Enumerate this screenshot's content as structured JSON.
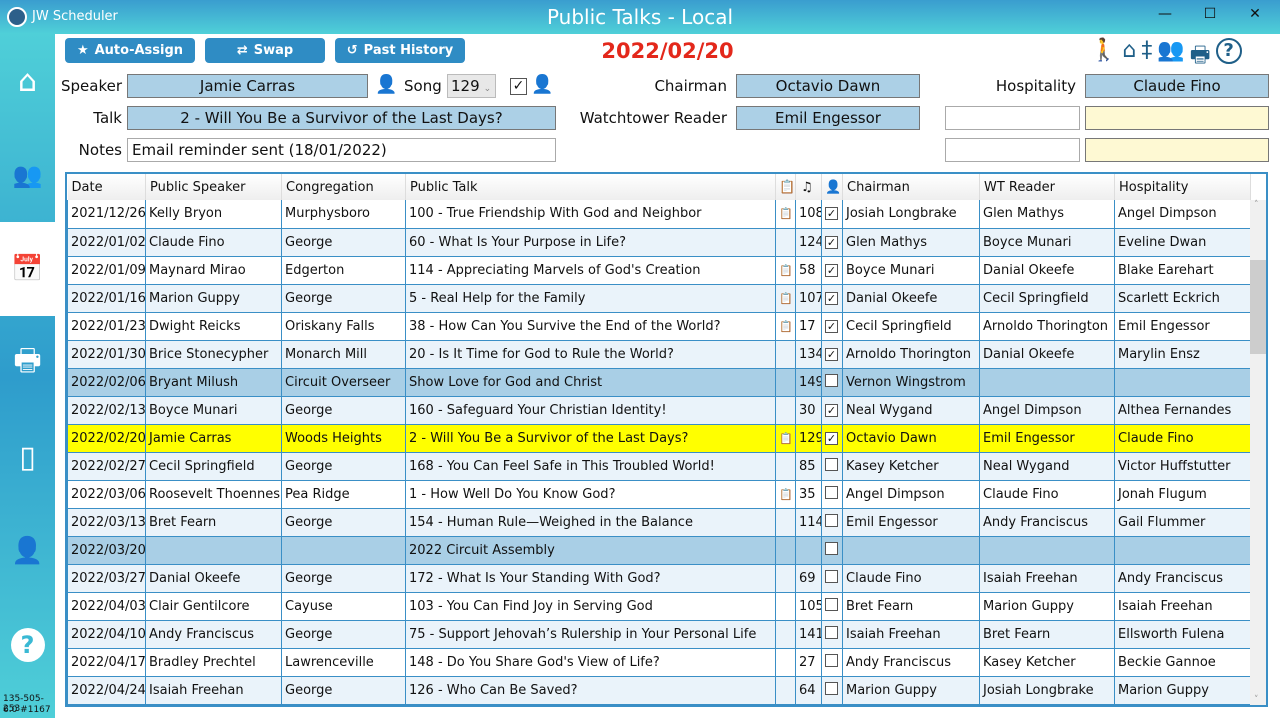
{
  "window": {
    "app_name": "JW Scheduler",
    "title": "Public Talks - Local",
    "minimize": "—",
    "maximize": "☐",
    "close": "✕"
  },
  "sidebar": {
    "items": [
      {
        "name": "home",
        "icon": "⌂"
      },
      {
        "name": "people",
        "icon": "👥"
      },
      {
        "name": "calendar",
        "icon": "📅",
        "active": true
      },
      {
        "name": "print",
        "icon": "🖶"
      },
      {
        "name": "phone",
        "icon": "▯"
      },
      {
        "name": "user-check",
        "icon": "👤"
      },
      {
        "name": "help",
        "icon": "?"
      }
    ],
    "version_line1": "135-505-253",
    "version_line2": "6.0 #1167"
  },
  "toolbar": {
    "auto_assign": "Auto-Assign",
    "swap": "Swap",
    "past_history": "Past History",
    "date": "2022/02/20"
  },
  "form": {
    "speaker_label": "Speaker",
    "speaker": "Jamie Carras",
    "song_label": "Song",
    "song": "129",
    "talk_label": "Talk",
    "talk": "2 - Will You Be a Survivor of the Last Days?",
    "notes_label": "Notes",
    "notes": "Email reminder sent (18/01/2022)",
    "chairman_label": "Chairman",
    "chairman": "Octavio Dawn",
    "reader_label": "Watchtower Reader",
    "reader": "Emil Engessor",
    "hospitality_label": "Hospitality",
    "hospitality": "Claude Fino"
  },
  "table": {
    "headers": [
      "Date",
      "Public Speaker",
      "Congregation",
      "Public Talk",
      "",
      "",
      "",
      "Chairman",
      "WT Reader",
      "Hospitality"
    ],
    "rows": [
      [
        "2021/12/26",
        "Kelly Bryon",
        "Murphysboro",
        "100 - True Friendship With God and Neighbor",
        true,
        "108",
        true,
        "Josiah Longbrake",
        "Glen Mathys",
        "Angel Dimpson",
        ""
      ],
      [
        "2022/01/02",
        "Claude Fino",
        "George",
        "60 - What Is Your Purpose in Life?",
        false,
        "124",
        true,
        "Glen Mathys",
        "Boyce Munari",
        "Eveline Dwan",
        ""
      ],
      [
        "2022/01/09",
        "Maynard Mirao",
        "Edgerton",
        "114 - Appreciating Marvels of God's Creation",
        true,
        "58",
        true,
        "Boyce Munari",
        "Danial Okeefe",
        "Blake Earehart",
        ""
      ],
      [
        "2022/01/16",
        "Marion Guppy",
        "George",
        "5 - Real Help for the Family",
        true,
        "107",
        true,
        "Danial Okeefe",
        "Cecil Springfield",
        "Scarlett Eckrich",
        ""
      ],
      [
        "2022/01/23",
        "Dwight Reicks",
        "Oriskany Falls",
        "38 - How Can You Survive the End of the World?",
        true,
        "17",
        true,
        "Cecil Springfield",
        "Arnoldo Thorington",
        "Emil Engessor",
        ""
      ],
      [
        "2022/01/30",
        "Brice Stonecypher",
        "Monarch Mill",
        "20 - Is It Time for God to Rule the World?",
        false,
        "134",
        true,
        "Arnoldo Thorington",
        "Danial Okeefe",
        "Marylin Ensz",
        ""
      ],
      [
        "2022/02/06",
        "Bryant Milush",
        "Circuit Overseer",
        "Show Love for God and Christ",
        false,
        "149",
        false,
        "Vernon Wingstrom",
        "",
        "",
        "special"
      ],
      [
        "2022/02/13",
        "Boyce Munari",
        "George",
        "160 - Safeguard Your Christian Identity!",
        false,
        "30",
        true,
        "Neal Wygand",
        "Angel Dimpson",
        "Althea Fernandes",
        ""
      ],
      [
        "2022/02/20",
        "Jamie Carras",
        "Woods Heights",
        "2 - Will You Be a Survivor of the Last Days?",
        true,
        "129",
        true,
        "Octavio Dawn",
        "Emil Engessor",
        "Claude Fino",
        "current"
      ],
      [
        "2022/02/27",
        "Cecil Springfield",
        "George",
        "168 - You Can Feel Safe in This Troubled World!",
        false,
        "85",
        false,
        "Kasey Ketcher",
        "Neal Wygand",
        "Victor Huffstutter",
        ""
      ],
      [
        "2022/03/06",
        "Roosevelt Thoennes",
        "Pea Ridge",
        "1 - How Well Do You Know God?",
        true,
        "35",
        false,
        "Angel Dimpson",
        "Claude Fino",
        "Jonah Flugum",
        ""
      ],
      [
        "2022/03/13",
        "Bret Fearn",
        "George",
        "154 - Human Rule—Weighed in the Balance",
        false,
        "114",
        false,
        "Emil Engessor",
        "Andy Franciscus",
        "Gail Flummer",
        ""
      ],
      [
        "2022/03/20",
        "",
        "",
        "2022 Circuit Assembly",
        false,
        "",
        false,
        "",
        "",
        "",
        "special"
      ],
      [
        "2022/03/27",
        "Danial Okeefe",
        "George",
        "172 - What Is Your Standing With God?",
        false,
        "69",
        false,
        "Claude Fino",
        "Isaiah Freehan",
        "Andy Franciscus",
        ""
      ],
      [
        "2022/04/03",
        "Clair Gentilcore",
        "Cayuse",
        "103 - You Can Find Joy in Serving God",
        false,
        "105",
        false,
        "Bret Fearn",
        "Marion Guppy",
        "Isaiah Freehan",
        ""
      ],
      [
        "2022/04/10",
        "Andy Franciscus",
        "George",
        "75 - Support Jehovah’s Rulership in Your Personal Life",
        false,
        "141",
        false,
        "Isaiah Freehan",
        "Bret Fearn",
        "Ellsworth Fulena",
        ""
      ],
      [
        "2022/04/17",
        "Bradley Prechtel",
        "Lawrenceville",
        "148 - Do You Share God's View of Life?",
        false,
        "27",
        false,
        "Andy Franciscus",
        "Kasey Ketcher",
        "Beckie Gannoe",
        ""
      ],
      [
        "2022/04/24",
        "Isaiah Freehan",
        "George",
        "126 - Who Can Be Saved?",
        false,
        "64",
        false,
        "Marion Guppy",
        "Josiah Longbrake",
        "Marion Guppy",
        ""
      ]
    ]
  },
  "colors": {
    "accent": "#2f8cc4",
    "date": "#e3281b",
    "current_row": "#ffff00",
    "special_row": "#a9cfe6"
  }
}
